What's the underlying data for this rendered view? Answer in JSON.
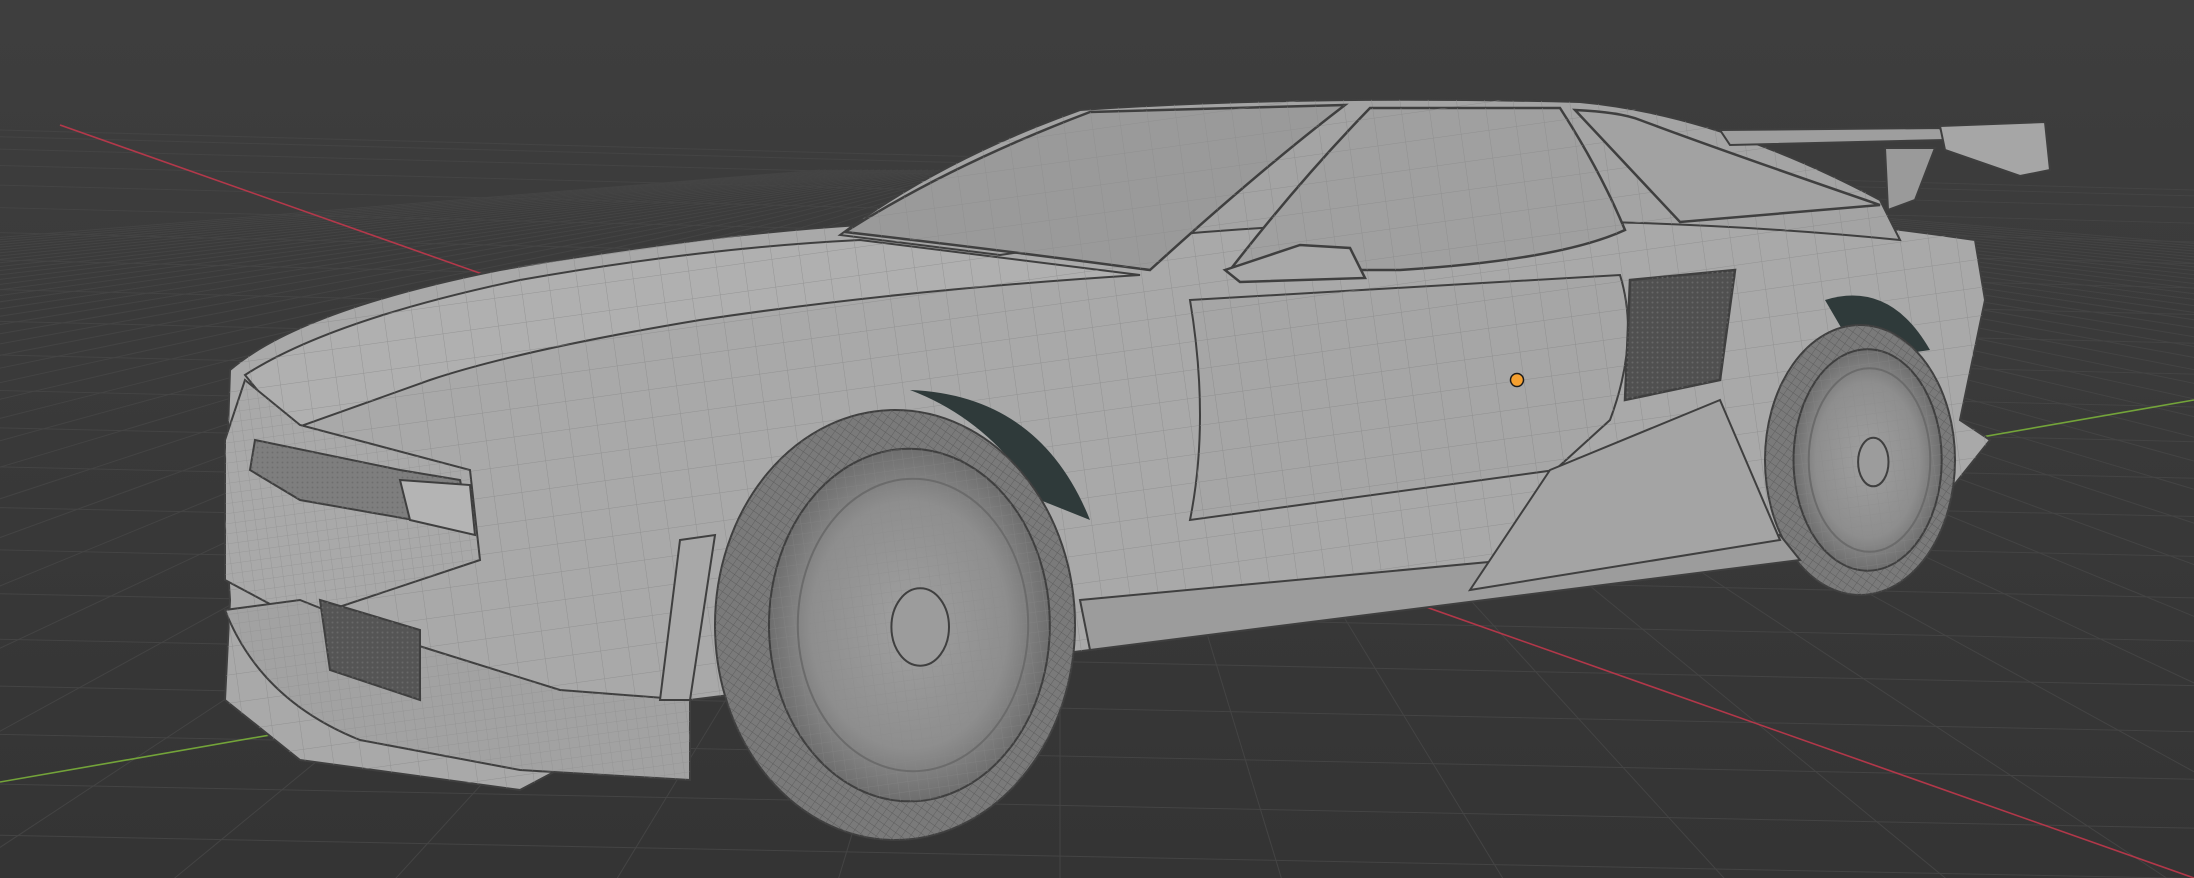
{
  "viewport": {
    "background_color": "#3a3a3a",
    "grid_color": "#444444",
    "x_axis_color": "#c0384c",
    "y_axis_color": "#7ab03a",
    "origin_color": "#f5a030",
    "car_body_color": "#a9a9a9",
    "car_shadow_color": "#6e6e6e",
    "wire_color": "#8c8c8c",
    "edge_color": "#3f3f3f",
    "glass_color": "#9a9a9a",
    "dark_gap_color": "#2f3a3a",
    "tire_color": "#7a7a7a"
  },
  "scene": {
    "object": "car-mesh",
    "shading_mode": "solid-wireframe",
    "icons": [
      "object-origin-icon"
    ]
  }
}
